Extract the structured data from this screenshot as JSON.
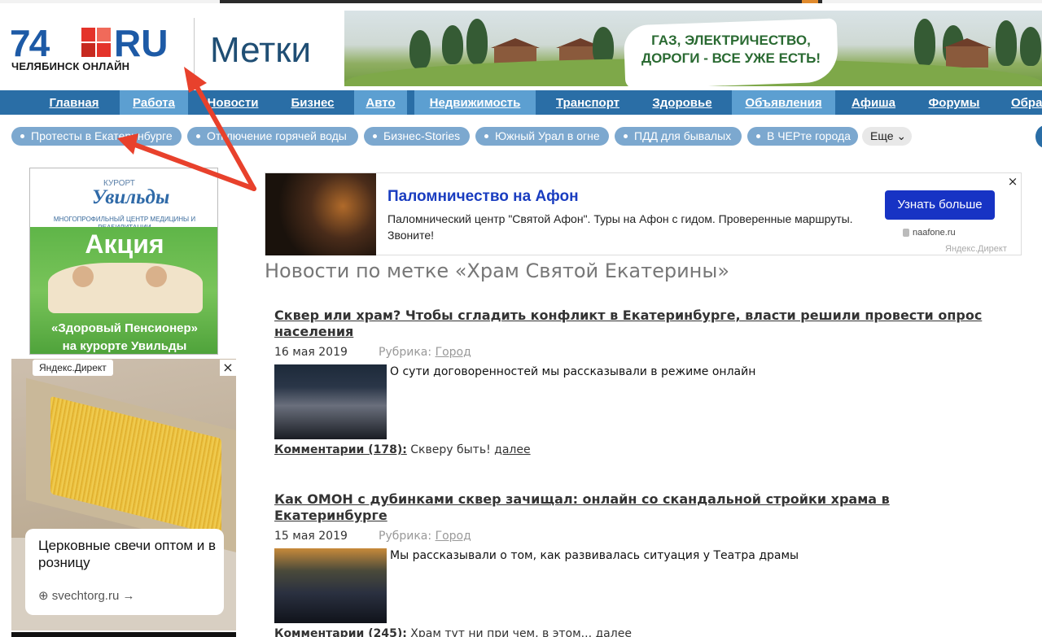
{
  "header": {
    "logo_number": "74",
    "logo_domain": "RU",
    "logo_subtitle": "ЧЕЛЯБИНСК ОНЛАЙН",
    "page_title": "Метки",
    "banner_line1": "ГАЗ, ЭЛЕКТРИЧЕСТВО,",
    "banner_line2": "ДОРОГИ - ВСЕ УЖЕ ЕСТЬ!"
  },
  "nav": [
    "Главная",
    "Работа",
    "Новости",
    "Бизнес",
    "Авто",
    "Недвижимость",
    "Транспорт",
    "Здоровье",
    "Объявления",
    "Афиша",
    "Форумы",
    "Обра"
  ],
  "tags": [
    "Протесты в Екатеринбурге",
    "Отключение горячей воды",
    "Бизнес-Stories",
    "Южный Урал в огне",
    "ПДД для бывалых",
    "В ЧЕРте города"
  ],
  "tags_more": "Еще",
  "ad_left": {
    "brand_small": "КУРОРТ",
    "brand": "Увильды",
    "subtitle": "МНОГОПРОФИЛЬНЫЙ ЦЕНТР МЕДИЦИНЫ И РЕАБИЛИТАЦИИ",
    "promo": "Акция",
    "line1": "«Здоровый Пенсионер»",
    "line2": "на курорте Увильды"
  },
  "ad_left2": {
    "label": "Яндекс.Директ",
    "close": "×",
    "title": "Церковные свечи оптом и в розницу",
    "link": "svechtorg.ru →"
  },
  "ad_direct": {
    "title": "Паломничество на Афон",
    "text": "Паломнический центр \"Святой Афон\". Туры на Афон с гидом. Проверенные маршруты. Звоните!",
    "button": "Узнать больше",
    "domain": "naafone.ru",
    "network": "Яндекс.Директ",
    "close": "×"
  },
  "news": {
    "heading": "Новости по метке «Храм Святой Екатерины»",
    "rubric_label": "Рубрика:",
    "articles": [
      {
        "title": "Сквер или храм? Чтобы сгладить конфликт в Екатеринбурге, власти решили провести опрос населения",
        "date": "16 мая 2019",
        "rubric": "Город",
        "lead": "О сути договоренностей мы рассказывали в режиме онлайн",
        "comments": "Комментарии (178):",
        "comment_text": "Скверу быть!",
        "more": "далее"
      },
      {
        "title": "Как ОМОН с дубинками сквер зачищал: онлайн со скандальной стройки храма в Екатеринбурге",
        "date": "15 мая 2019",
        "rubric": "Город",
        "lead": "Мы рассказывали о том, как развивалась ситуация у Театра драмы",
        "comments": "Комментарии (245):",
        "comment_text": "Храм тут ни при чем, в этом...",
        "more": "далее"
      }
    ]
  },
  "colors": {
    "nav": "#2a6ea6",
    "nav_alt": "#5c9fd1",
    "tag": "#7ca8cf",
    "logo_blue": "#1d5aa6",
    "logo_red": "#e4332a",
    "annotation_arrow": "#e8412c",
    "ad_button": "#1733c4"
  }
}
